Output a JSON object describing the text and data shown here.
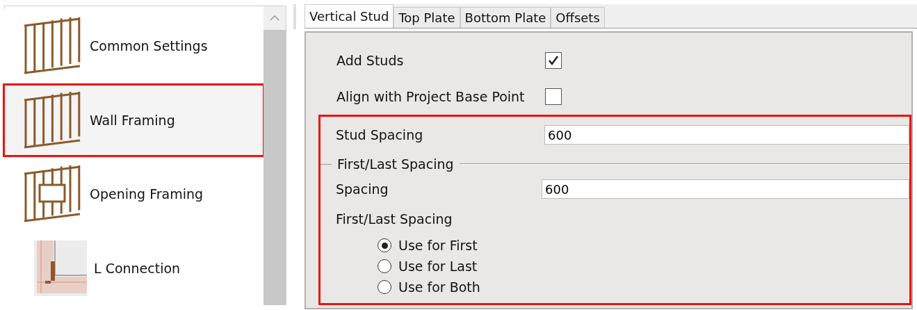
{
  "sidebar": {
    "items": [
      {
        "label": "Common Settings",
        "kind": "studs",
        "selected": false
      },
      {
        "label": "Wall Framing",
        "kind": "studs",
        "selected": true
      },
      {
        "label": "Opening Framing",
        "kind": "opening",
        "selected": false
      },
      {
        "label": "L Connection",
        "kind": "corner",
        "selected": false
      }
    ]
  },
  "tabs": [
    {
      "label": "Vertical Stud",
      "selected": true
    },
    {
      "label": "Top Plate",
      "selected": false
    },
    {
      "label": "Bottom Plate",
      "selected": false
    },
    {
      "label": "Offsets",
      "selected": false
    }
  ],
  "options": [
    {
      "label": "Add Studs",
      "checked": true
    },
    {
      "label": "Align with Project Base Point",
      "checked": false
    }
  ],
  "spacing_section": {
    "highlighted": true,
    "stud_spacing": {
      "label": "Stud Spacing",
      "value": "600"
    },
    "group_title": "First/Last Spacing",
    "spacing": {
      "label": "Spacing",
      "value": "600"
    },
    "radio_title": "First/Last Spacing",
    "radios": [
      {
        "label": "Use for First",
        "selected": true
      },
      {
        "label": "Use for Last",
        "selected": false
      },
      {
        "label": "Use for Both",
        "selected": false
      }
    ]
  }
}
